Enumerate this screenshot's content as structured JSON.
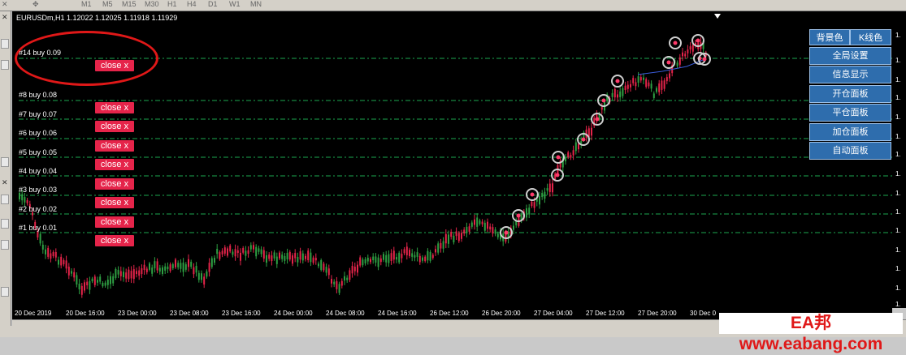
{
  "chart": {
    "symbol_line": "EURUSDm,H1  1.12022 1.12025 1.11918 1.11929"
  },
  "orders": [
    {
      "label": "#14 buy 0.09",
      "close": "close x"
    },
    {
      "label": "#8 buy 0.08",
      "close": "close x"
    },
    {
      "label": "#7 buy 0.07",
      "close": "close x"
    },
    {
      "label": "#6 buy 0.06",
      "close": "close x"
    },
    {
      "label": "#5 buy 0.05",
      "close": "close x"
    },
    {
      "label": "#4 buy 0.04",
      "close": "close x"
    },
    {
      "label": "#3 buy 0.03",
      "close": "close x"
    },
    {
      "label": "#2 buy 0.02",
      "close": "close x"
    },
    {
      "label": "#1 buy 0.01",
      "close": "close x"
    }
  ],
  "panel": {
    "bg_color": "背景色",
    "k_color": "K线色",
    "global_settings": "全局设置",
    "info_display": "信息显示",
    "open_panel": "开仓面板",
    "close_panel": "平仓面板",
    "add_panel": "加仓面板",
    "auto_panel": "自动面板"
  },
  "price_axis": [
    "1.",
    "1.",
    "1.",
    "1.",
    "1.",
    "1.",
    "1.",
    "1.",
    "1.",
    "1.",
    "1.",
    "1.",
    "1.",
    "1.",
    "1."
  ],
  "time_axis": [
    "20 Dec 2019",
    "20 Dec 16:00",
    "23 Dec 00:00",
    "23 Dec 08:00",
    "23 Dec 16:00",
    "24 Dec 00:00",
    "24 Dec 08:00",
    "24 Dec 16:00",
    "26 Dec 12:00",
    "26 Dec 20:00",
    "27 Dec 04:00",
    "27 Dec 12:00",
    "27 Dec 20:00",
    "30 Dec 0"
  ],
  "timeframes": [
    "M1",
    "M5",
    "M15",
    "M30",
    "H1",
    "H4",
    "D1",
    "W1",
    "MN"
  ],
  "watermark": "EA邦 www.eabang.com",
  "colors": {
    "bull_candle": "#e5244a",
    "bear_candle": "#2ea043",
    "grid_line": "#22c55e",
    "close_button": "#e5244a",
    "panel_button": "#2e6dad",
    "highlight_ring": "#e01818"
  }
}
